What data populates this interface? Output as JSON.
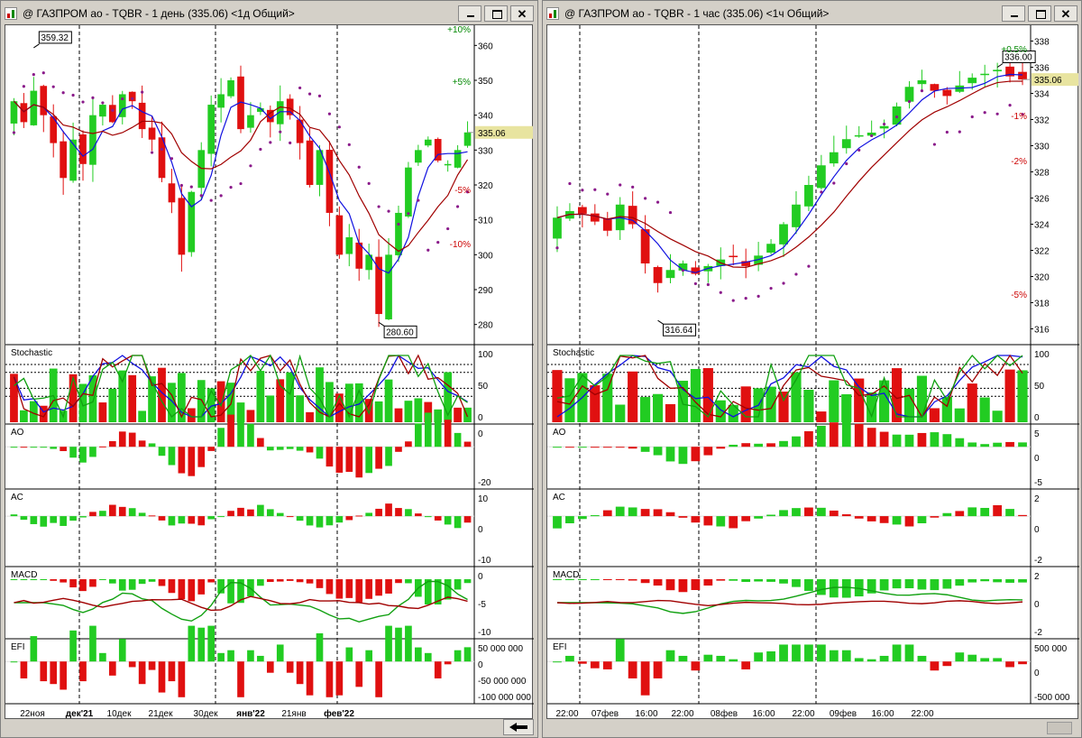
{
  "windows": [
    {
      "title": "@ ГАЗПРОМ ао - TQBR - 1 день (335.06) <1д Общий>",
      "last_price": "335.06",
      "annotations": {
        "high": "359.32",
        "low": "280.60"
      },
      "percent_marks": [
        "+10%",
        "+5%",
        "-5%",
        "-10%"
      ],
      "panels": [
        "Stochastic",
        "AO",
        "AC",
        "MACD",
        "EFI"
      ],
      "xlabels": [
        "22ноя",
        "дек'21",
        "10дек",
        "21дек",
        "30дек",
        "янв'22",
        "21янв",
        "фев'22"
      ],
      "price_axis": [
        "360",
        "350",
        "340",
        "330",
        "320",
        "310",
        "300",
        "290",
        "280"
      ],
      "stoch_axis": [
        "100",
        "50",
        "0"
      ],
      "ao_axis": [
        "0",
        "-20"
      ],
      "ac_axis": [
        "10",
        "0",
        "-10"
      ],
      "macd_axis": [
        "0",
        "-5",
        "-10"
      ],
      "efi_axis": [
        "50 000 000",
        "0",
        "-50 000 000",
        "-100 000 000"
      ]
    },
    {
      "title": "@ ГАЗПРОМ ао - TQBR - 1 час (335.06) <1ч Общий>",
      "last_price": "335.06",
      "annotations": {
        "high": "336.00",
        "low": "316.64"
      },
      "percent_marks": [
        "+0.5%",
        "-1%",
        "-2%",
        "-5%"
      ],
      "panels": [
        "Stochastic",
        "AO",
        "AC",
        "MACD",
        "EFI"
      ],
      "xlabels": [
        "22:00",
        "07фев",
        "16:00",
        "22:00",
        "08фев",
        "16:00",
        "22:00",
        "09фев",
        "16:00",
        "22:00"
      ],
      "price_axis": [
        "338",
        "336",
        "334",
        "332",
        "330",
        "328",
        "326",
        "324",
        "322",
        "320",
        "318",
        "316"
      ],
      "stoch_axis": [
        "100",
        "50",
        "0"
      ],
      "ao_axis": [
        "5",
        "0",
        "-5"
      ],
      "ac_axis": [
        "2",
        "0",
        "-2"
      ],
      "macd_axis": [
        "2",
        "0",
        "-2"
      ],
      "efi_axis": [
        "500 000",
        "0",
        "-500 000"
      ]
    }
  ],
  "chart_data": [
    {
      "type": "candlestick",
      "title": "@ ГАЗПРОМ ао - TQBR - 1 день (335.06) <1д Общий>",
      "ylim": [
        275,
        365
      ],
      "x": [
        "22ноя",
        "дек'21",
        "10дек",
        "21дек",
        "30дек",
        "янв'22",
        "21янв",
        "фев'22"
      ],
      "close_series": [
        344,
        338,
        347,
        340,
        332,
        322,
        333,
        326,
        340,
        343,
        338,
        346,
        344,
        336,
        333,
        322,
        315,
        300,
        318,
        330,
        343,
        346,
        350,
        336,
        340,
        342,
        338,
        344,
        340,
        332,
        320,
        330,
        312,
        300,
        305,
        296,
        300,
        283,
        300,
        312,
        325,
        330,
        333,
        327,
        326,
        330,
        335.06
      ],
      "last": 335.06,
      "high_label": 359.32,
      "low_label": 280.6,
      "colors": {
        "up": "#22cc22",
        "down": "#e01010",
        "ma_fast": "#1010e0",
        "ma_slow": "#a00000",
        "sar": "#8a1a8a"
      }
    },
    {
      "type": "candlestick",
      "title": "@ ГАЗПРОМ ао - TQBR - 1 час (335.06) <1ч Общий>",
      "ylim": [
        315,
        339
      ],
      "x": [
        "22:00",
        "07фев",
        "16:00",
        "22:00",
        "08фев",
        "16:00",
        "22:00",
        "09фев",
        "16:00",
        "22:00"
      ],
      "close_series": [
        324.5,
        325,
        324.8,
        324.2,
        323.5,
        325.5,
        324,
        321,
        319.5,
        320.5,
        321,
        320.2,
        320.8,
        321.3,
        321.5,
        320.8,
        321.6,
        322.5,
        324,
        325.5,
        327,
        328.5,
        329.5,
        330.5,
        330.8,
        331,
        331.5,
        333,
        334.5,
        335,
        334.2,
        333.8,
        334.6,
        335.2,
        335.5,
        335.8,
        335.3,
        335.06
      ],
      "last": 335.06,
      "high_label": 336.0,
      "low_label": 316.64,
      "colors": {
        "up": "#22cc22",
        "down": "#e01010",
        "ma_fast": "#1010e0",
        "ma_slow": "#a00000",
        "sar": "#8a1a8a"
      }
    }
  ]
}
